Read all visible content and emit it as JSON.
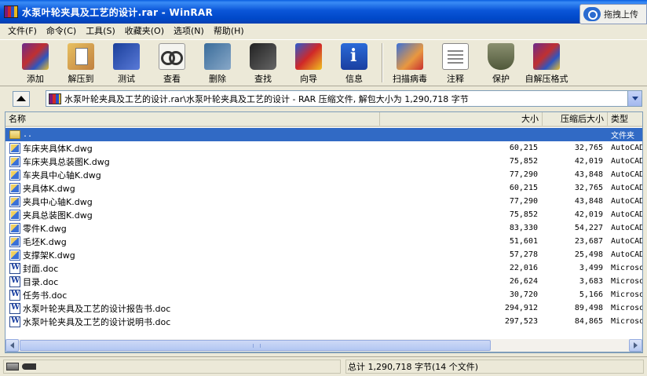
{
  "window": {
    "title": "水泵叶轮夹具及工艺的设计.rar - WinRAR",
    "upload_label": "拖拽上传"
  },
  "menu": [
    "文件(F)",
    "命令(C)",
    "工具(S)",
    "收藏夹(O)",
    "选项(N)",
    "帮助(H)"
  ],
  "toolbar": [
    {
      "key": "add",
      "label": "添加",
      "icon": "archive-add-icon"
    },
    {
      "key": "extract",
      "label": "解压到",
      "icon": "extract-icon"
    },
    {
      "key": "test",
      "label": "测试",
      "icon": "test-icon"
    },
    {
      "key": "view",
      "label": "查看",
      "icon": "view-glasses-icon"
    },
    {
      "key": "delete",
      "label": "删除",
      "icon": "delete-icon"
    },
    {
      "key": "find",
      "label": "查找",
      "icon": "binoculars-icon"
    },
    {
      "key": "wizard",
      "label": "向导",
      "icon": "wizard-icon"
    },
    {
      "key": "info",
      "label": "信息",
      "icon": "info-icon"
    },
    {
      "key": "scan",
      "label": "扫描病毒",
      "icon": "virus-scan-icon"
    },
    {
      "key": "comment",
      "label": "注释",
      "icon": "comment-icon"
    },
    {
      "key": "protect",
      "label": "保护",
      "icon": "shield-icon"
    },
    {
      "key": "sfx",
      "label": "自解压格式",
      "icon": "sfx-icon"
    }
  ],
  "path": {
    "text": "水泵叶轮夹具及工艺的设计.rar\\水泵叶轮夹具及工艺的设计 - RAR 压缩文件, 解包大小为 1,290,718 字节"
  },
  "columns": {
    "name": "名称",
    "size": "大小",
    "packed": "压缩后大小",
    "type": "类型"
  },
  "files": [
    {
      "name": "..",
      "size": "",
      "packed": "",
      "type": "文件夹",
      "kind": "folder",
      "selected": true
    },
    {
      "name": "车床夹具体K.dwg",
      "size": "60,215",
      "packed": "32,765",
      "type": "AutoCAD",
      "kind": "dwg"
    },
    {
      "name": "车床夹具总装图K.dwg",
      "size": "75,852",
      "packed": "42,019",
      "type": "AutoCAD",
      "kind": "dwg"
    },
    {
      "name": "车夹具中心轴K.dwg",
      "size": "77,290",
      "packed": "43,848",
      "type": "AutoCAD",
      "kind": "dwg"
    },
    {
      "name": "夹具体K.dwg",
      "size": "60,215",
      "packed": "32,765",
      "type": "AutoCAD",
      "kind": "dwg"
    },
    {
      "name": "夹具中心轴K.dwg",
      "size": "77,290",
      "packed": "43,848",
      "type": "AutoCAD",
      "kind": "dwg"
    },
    {
      "name": "夹具总装图K.dwg",
      "size": "75,852",
      "packed": "42,019",
      "type": "AutoCAD",
      "kind": "dwg"
    },
    {
      "name": "零件K.dwg",
      "size": "83,330",
      "packed": "54,227",
      "type": "AutoCAD",
      "kind": "dwg"
    },
    {
      "name": "毛坯K.dwg",
      "size": "51,601",
      "packed": "23,687",
      "type": "AutoCAD",
      "kind": "dwg"
    },
    {
      "name": "支撑架K.dwg",
      "size": "57,278",
      "packed": "25,498",
      "type": "AutoCAD",
      "kind": "dwg"
    },
    {
      "name": "封面.doc",
      "size": "22,016",
      "packed": "3,499",
      "type": "Microsoft",
      "kind": "doc"
    },
    {
      "name": "目录.doc",
      "size": "26,624",
      "packed": "3,683",
      "type": "Microsoft",
      "kind": "doc"
    },
    {
      "name": "任务书.doc",
      "size": "30,720",
      "packed": "5,166",
      "type": "Microsoft",
      "kind": "doc"
    },
    {
      "name": "水泵叶轮夹具及工艺的设计报告书.doc",
      "size": "294,912",
      "packed": "89,498",
      "type": "Microsoft",
      "kind": "doc"
    },
    {
      "name": "水泵叶轮夹具及工艺的设计说明书.doc",
      "size": "297,523",
      "packed": "84,865",
      "type": "Microsoft",
      "kind": "doc"
    }
  ],
  "status": {
    "text": "总计 1,290,718 字节(14 个文件)"
  }
}
